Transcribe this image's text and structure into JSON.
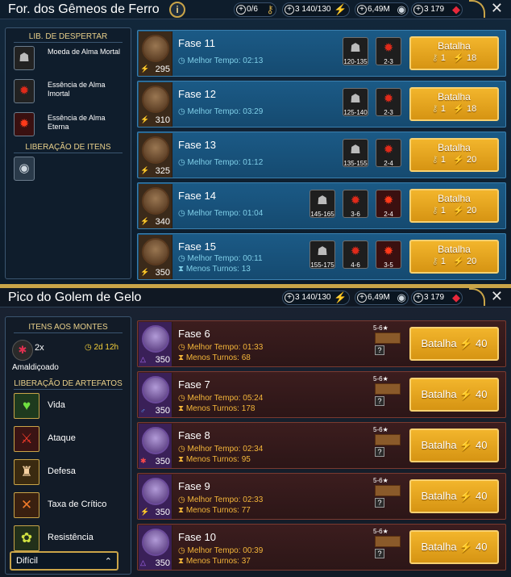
{
  "p1": {
    "title": "For. dos Gêmeos de Ferro",
    "info": "i",
    "res_keys": "0/6",
    "res_energy": "3 140/130",
    "res_silver": "6,49M",
    "res_gems": "3 179",
    "close": "✕",
    "sidebar": {
      "header": "LIB. DE DESPERTAR",
      "items": [
        {
          "label": "Moeda de Alma Mortal"
        },
        {
          "label": "Essência de Alma Imortal"
        },
        {
          "label": "Essência de Alma Eterna"
        }
      ],
      "header2": "LIBERAÇÃO DE ITENS"
    },
    "rows": [
      {
        "name": "Fase 11",
        "level": "295",
        "time": "Melhor Tempo: 02:13",
        "turns": "",
        "d1": "120-135",
        "d2": "2-3",
        "d3": "",
        "keys": "1",
        "energy": "18"
      },
      {
        "name": "Fase 12",
        "level": "310",
        "time": "Melhor Tempo: 03:29",
        "turns": "",
        "d1": "125-140",
        "d2": "2-3",
        "d3": "",
        "keys": "1",
        "energy": "18"
      },
      {
        "name": "Fase 13",
        "level": "325",
        "time": "Melhor Tempo: 01:12",
        "turns": "",
        "d1": "135-155",
        "d2": "2-4",
        "d3": "",
        "keys": "1",
        "energy": "20"
      },
      {
        "name": "Fase 14",
        "level": "340",
        "time": "Melhor Tempo: 01:04",
        "turns": "",
        "d1": "145-165",
        "d2": "3-6",
        "d3": "2-4",
        "keys": "1",
        "energy": "20"
      },
      {
        "name": "Fase 15",
        "level": "350",
        "time": "Melhor Tempo: 00:11",
        "turns": "Menos Turnos: 13",
        "d1": "155-175",
        "d2": "4-6",
        "d3": "3-5",
        "keys": "1",
        "energy": "20"
      }
    ],
    "battle": "Batalha"
  },
  "p2": {
    "title": "Pico do Golem de Gelo",
    "res_energy": "3 140/130",
    "res_silver": "6,49M",
    "res_gems": "3 179",
    "close": "✕",
    "sidebar": {
      "header": "ITENS AOS MONTES",
      "mult": "2x",
      "timer": "2d 12h",
      "cursed": "Amaldiçoado",
      "header2": "LIBERAÇÃO DE ARTEFATOS",
      "artifacts": [
        {
          "label": "Vida"
        },
        {
          "label": "Ataque"
        },
        {
          "label": "Defesa"
        },
        {
          "label": "Taxa de Crítico"
        },
        {
          "label": "Resistência"
        }
      ],
      "difficulty": "Difícil"
    },
    "rows": [
      {
        "name": "Fase 6",
        "level": "350",
        "time": "Melhor Tempo: 01:33",
        "turns": "Menos Turnos: 68",
        "rank": "5-6★",
        "energy": "40"
      },
      {
        "name": "Fase 7",
        "level": "350",
        "time": "Melhor Tempo: 05:24",
        "turns": "Menos Turnos: 178",
        "rank": "5-6★",
        "energy": "40"
      },
      {
        "name": "Fase 8",
        "level": "350",
        "time": "Melhor Tempo: 02:34",
        "turns": "Menos Turnos: 95",
        "rank": "5-6★",
        "energy": "40"
      },
      {
        "name": "Fase 9",
        "level": "350",
        "time": "Melhor Tempo: 02:33",
        "turns": "Menos Turnos: 77",
        "rank": "5-6★",
        "energy": "40"
      },
      {
        "name": "Fase 10",
        "level": "350",
        "time": "Melhor Tempo: 00:39",
        "turns": "Menos Turnos: 37",
        "rank": "5-6★",
        "energy": "40"
      }
    ],
    "battle": "Batalha"
  },
  "icons": {
    "plus": "+",
    "question": "?",
    "chevron": "⌃"
  },
  "colors": {
    "gold": "#c9a448",
    "button": "#e5a51f",
    "blue_row": "#1b5a86",
    "red_row": "#3c1d1e"
  }
}
